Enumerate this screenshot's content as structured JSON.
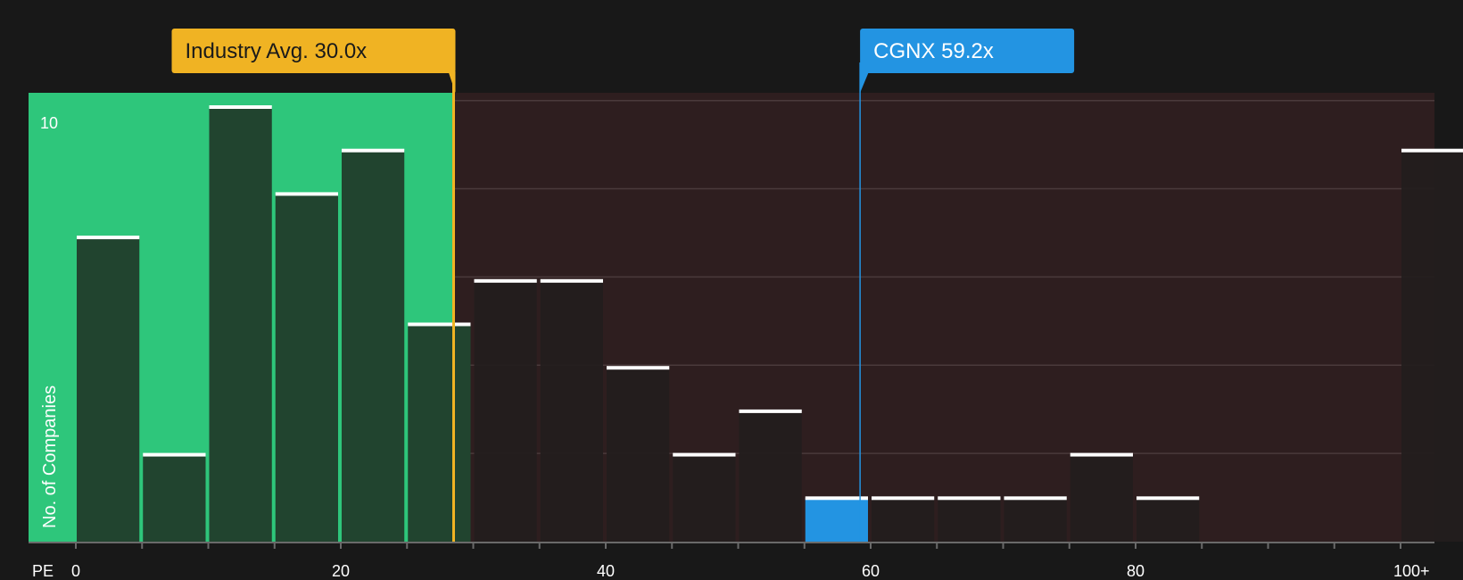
{
  "chart_data": {
    "type": "bar",
    "xlabel": "PE",
    "ylabel": "No. of Companies",
    "x_tick_labels": [
      "0",
      "20",
      "40",
      "60",
      "80",
      "100+"
    ],
    "x_tick_values": [
      0,
      20,
      40,
      60,
      80,
      100
    ],
    "y_tick_label": "10",
    "y_tick_value": 10,
    "ylim": [
      0,
      10.3
    ],
    "bin_width": 5,
    "bins": [
      {
        "x0": 0,
        "x1": 5,
        "value": 7
      },
      {
        "x0": 5,
        "x1": 10,
        "value": 2
      },
      {
        "x0": 10,
        "x1": 15,
        "value": 10
      },
      {
        "x0": 15,
        "x1": 20,
        "value": 8
      },
      {
        "x0": 20,
        "x1": 25,
        "value": 9
      },
      {
        "x0": 25,
        "x1": 30,
        "value": 5
      },
      {
        "x0": 30,
        "x1": 35,
        "value": 6
      },
      {
        "x0": 35,
        "x1": 40,
        "value": 6
      },
      {
        "x0": 40,
        "x1": 45,
        "value": 4
      },
      {
        "x0": 45,
        "x1": 50,
        "value": 2
      },
      {
        "x0": 50,
        "x1": 55,
        "value": 3
      },
      {
        "x0": 55,
        "x1": 60,
        "value": 1,
        "highlight": true
      },
      {
        "x0": 60,
        "x1": 65,
        "value": 1
      },
      {
        "x0": 65,
        "x1": 70,
        "value": 1
      },
      {
        "x0": 70,
        "x1": 75,
        "value": 1
      },
      {
        "x0": 75,
        "x1": 80,
        "value": 2
      },
      {
        "x0": 80,
        "x1": 85,
        "value": 1
      },
      {
        "x0": 85,
        "x1": 90,
        "value": 0
      },
      {
        "x0": 90,
        "x1": 95,
        "value": 0
      },
      {
        "x0": 95,
        "x1": 100,
        "value": 0
      },
      {
        "x0": 100,
        "x1": 105,
        "value": 9
      }
    ],
    "annotations": [
      {
        "label": "Industry Avg. 30.0x",
        "value": 30.0,
        "color": "#f0b323",
        "text_color": "#1a1a1a"
      },
      {
        "label": "CGNX 59.2x",
        "value": 59.2,
        "color": "#2394e2",
        "text_color": "#ffffff"
      }
    ],
    "colors": {
      "background": "#181818",
      "fair_zone": "#2ec67b",
      "expensive_zone": "#2e1e1f",
      "bar_fair": "#21442f",
      "bar_expensive": "#231e1e",
      "bar_highlight": "#2394e2",
      "bar_cap": "#ffffff",
      "grid": "#4a3a3b"
    },
    "grid": true
  }
}
